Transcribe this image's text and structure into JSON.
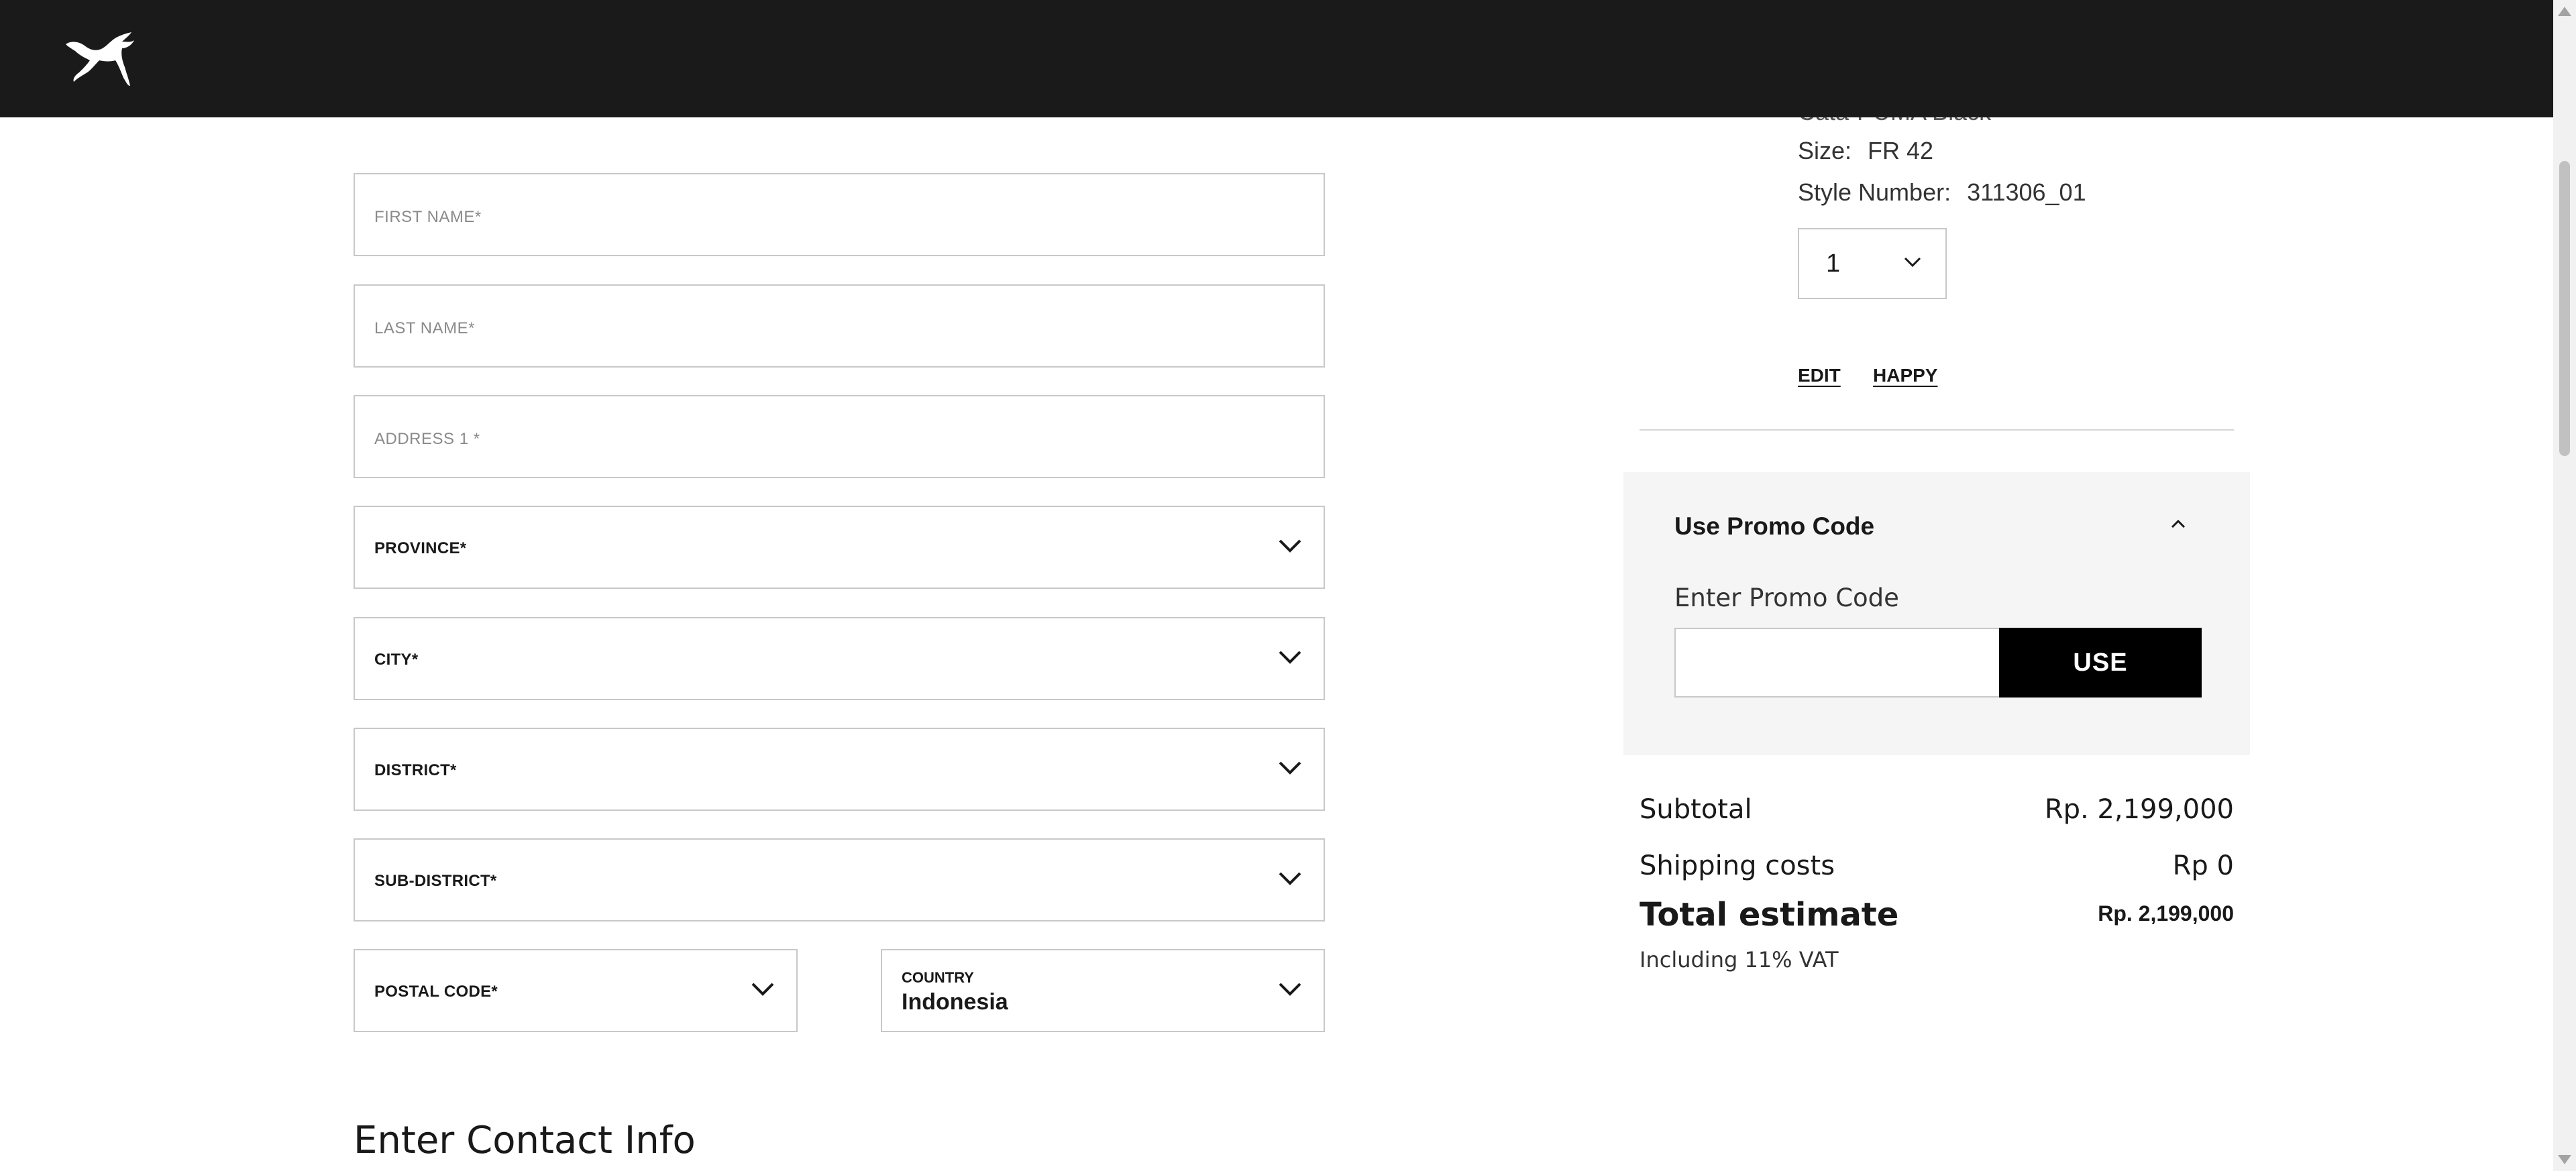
{
  "header": {
    "logo": "puma-logo-icon"
  },
  "form": {
    "first_name": {
      "placeholder": "FIRST NAME*"
    },
    "last_name": {
      "placeholder": "LAST NAME*"
    },
    "address1": {
      "placeholder": "ADDRESS 1 *"
    },
    "province": {
      "label": "PROVINCE*"
    },
    "city": {
      "label": "CITY*"
    },
    "district": {
      "label": "DISTRICT*"
    },
    "sub_district": {
      "label": "SUB-DISTRICT*"
    },
    "postal_code": {
      "label": "POSTAL CODE*"
    },
    "country": {
      "label": "COUNTRY",
      "value": "Indonesia"
    }
  },
  "contact_section": {
    "title": "Enter Contact Info"
  },
  "cart_item": {
    "name_partial": "Cata-PUMA Black",
    "size_label": "Size:",
    "size_value": "FR 42",
    "style_label": "Style Number:",
    "style_value": "311306_01",
    "quantity": "1",
    "edit_link": "EDIT",
    "happy_link": "HAPPY"
  },
  "promo": {
    "title": "Use Promo Code",
    "input_label": "Enter Promo Code",
    "input_value": "",
    "button_label": "USE"
  },
  "totals": {
    "subtotal_label": "Subtotal",
    "subtotal_value": "Rp. 2,199,000",
    "shipping_label": "Shipping costs",
    "shipping_value": "Rp 0",
    "total_label": "Total estimate",
    "total_value": "Rp. 2,199,000",
    "vat_note": "Including 11% VAT"
  }
}
